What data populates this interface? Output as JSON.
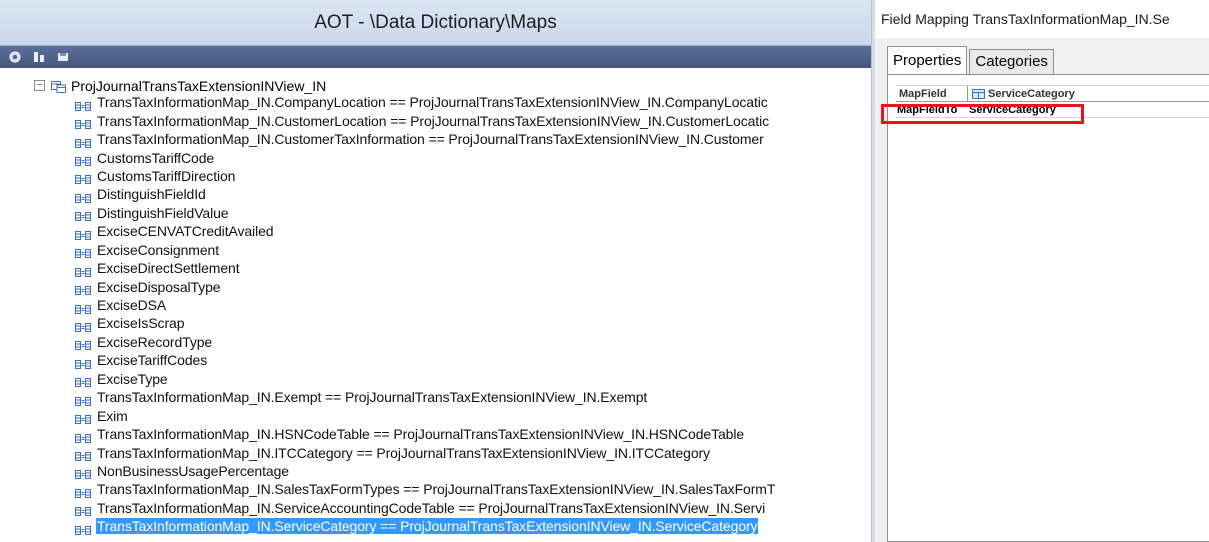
{
  "aot": {
    "title": "AOT - \\Data Dictionary\\Maps",
    "root_node": "ProjJournalTransTaxExtensionINView_IN",
    "rows": [
      "TransTaxInformationMap_IN.CompanyLocation == ProjJournalTransTaxExtensionINView_IN.CompanyLocatic",
      "TransTaxInformationMap_IN.CustomerLocation == ProjJournalTransTaxExtensionINView_IN.CustomerLocatic",
      "TransTaxInformationMap_IN.CustomerTaxInformation == ProjJournalTransTaxExtensionINView_IN.Customer",
      "CustomsTariffCode",
      "CustomsTariffDirection",
      "DistinguishFieldId",
      "DistinguishFieldValue",
      "ExciseCENVATCreditAvailed",
      "ExciseConsignment",
      "ExciseDirectSettlement",
      "ExciseDisposalType",
      "ExciseDSA",
      "ExciseIsScrap",
      "ExciseRecordType",
      "ExciseTariffCodes",
      "ExciseType",
      "TransTaxInformationMap_IN.Exempt == ProjJournalTransTaxExtensionINView_IN.Exempt",
      "Exim",
      "TransTaxInformationMap_IN.HSNCodeTable == ProjJournalTransTaxExtensionINView_IN.HSNCodeTable",
      "TransTaxInformationMap_IN.ITCCategory == ProjJournalTransTaxExtensionINView_IN.ITCCategory",
      "NonBusinessUsagePercentage",
      "TransTaxInformationMap_IN.SalesTaxFormTypes == ProjJournalTransTaxExtensionINView_IN.SalesTaxFormT",
      "TransTaxInformationMap_IN.ServiceAccountingCodeTable == ProjJournalTransTaxExtensionINView_IN.Servi",
      "TransTaxInformationMap_IN.ServiceCategory == ProjJournalTransTaxExtensionINView_IN.ServiceCategory"
    ],
    "selected_row": "TransTaxInformationMap_IN.ServiceCategory == ProjJournalTransTaxExtensionINView_IN.ServiceCategory"
  },
  "field_mapping": {
    "title": "Field Mapping TransTaxInformationMap_IN.Se",
    "tabs": [
      "Properties",
      "Categories"
    ],
    "active_tab": "Properties",
    "header_name": "MapField",
    "header_value": "ServiceCategory",
    "property_name": "MapFieldTo",
    "property_value": "ServiceCategory",
    "highlight_color": "#e8141c"
  },
  "colors": {
    "selection": "#3399ff",
    "title_bar": "#c9d7ea",
    "toolbar": "#4d5f87"
  }
}
